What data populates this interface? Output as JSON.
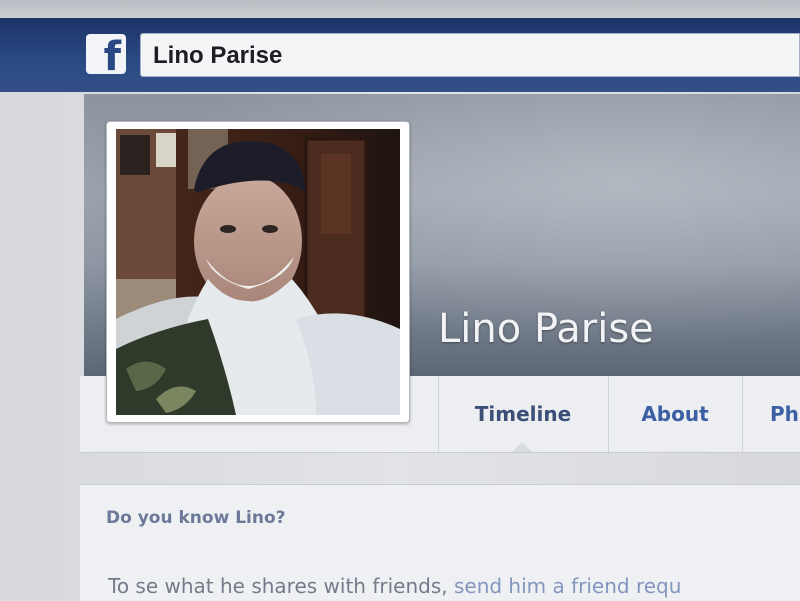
{
  "header": {
    "logo_glyph": "f",
    "search_value": "Lino Parise"
  },
  "profile": {
    "name": "Lino Parise",
    "photo_alt": "profile-photo"
  },
  "tabs": [
    {
      "label": "Timeline"
    },
    {
      "label": "About"
    },
    {
      "label": "Ph"
    }
  ],
  "card": {
    "title": "Do you know Lino?",
    "text_prefix": "To s",
    "text_middle": "e what he shares with friends, ",
    "link": "send him a friend requ"
  },
  "colors": {
    "topbar": "#2b4a85",
    "tab_active": "#3b4f77",
    "tab_link": "#3b5fa2",
    "card_title": "#6c7a98"
  }
}
